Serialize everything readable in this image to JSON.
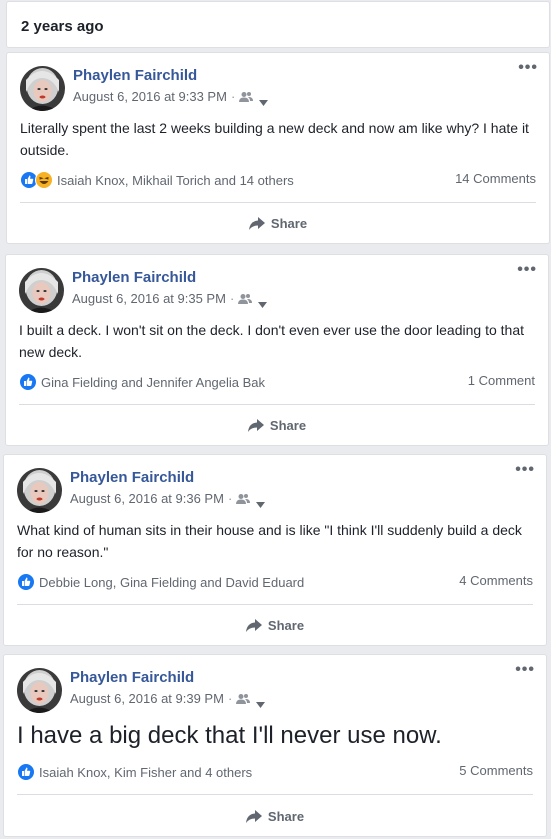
{
  "header": {
    "label": "2 years ago"
  },
  "colors": {
    "name_link": "#365899",
    "secondary_text": "#616770",
    "like_blue": "#1877f2",
    "haha_yellow": "#f7b125",
    "page_bg": "#e9ebee"
  },
  "icons": {
    "audience": "friends-icon",
    "caret": "chevron-down-icon",
    "more": "more-options-icon",
    "like": "like-reaction-icon",
    "haha": "haha-reaction-icon",
    "share": "share-arrow-icon"
  },
  "posts": [
    {
      "author": "Phaylen Fairchild",
      "timestamp": "August 6, 2016 at 9:33 PM",
      "separator": "·",
      "more": "•••",
      "text": "Literally spent the last 2 weeks building a new deck and now am like why? I hate it outside.",
      "reactions_text": "Isaiah Knox, Mikhail Torich and 14 others",
      "reaction_types": [
        "like",
        "haha"
      ],
      "comments": "14 Comments",
      "share_label": "Share"
    },
    {
      "author": "Phaylen Fairchild",
      "timestamp": "August 6, 2016 at 9:35 PM",
      "separator": "·",
      "more": "•••",
      "text": "I built a deck. I won't sit on the deck. I don't even ever use the door leading to that new deck.",
      "reactions_text": "Gina Fielding and Jennifer Angelia Bak",
      "reaction_types": [
        "like"
      ],
      "comments": "1 Comment",
      "share_label": "Share"
    },
    {
      "author": "Phaylen Fairchild",
      "timestamp": "August 6, 2016 at 9:36 PM",
      "separator": "·",
      "more": "•••",
      "text": "What kind of human sits in their house and is like \"I think I'll suddenly build a deck for no reason.\"",
      "reactions_text": "Debbie Long, Gina Fielding and David Eduard",
      "reaction_types": [
        "like"
      ],
      "comments": "4 Comments",
      "share_label": "Share"
    },
    {
      "author": "Phaylen Fairchild",
      "timestamp": "August 6, 2016 at 9:39 PM",
      "separator": "·",
      "more": "•••",
      "text": "I have a big deck that I'll never use now.",
      "reactions_text": "Isaiah Knox, Kim Fisher and 4 others",
      "reaction_types": [
        "like"
      ],
      "comments": "5 Comments",
      "share_label": "Share"
    }
  ]
}
